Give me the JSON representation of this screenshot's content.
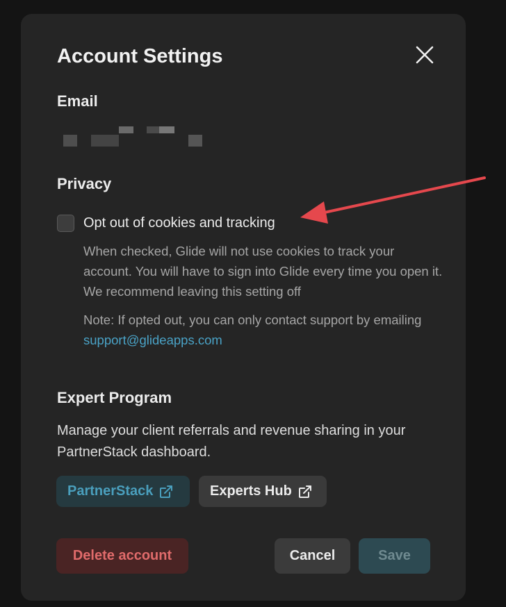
{
  "dialog": {
    "title": "Account Settings",
    "close_icon": "close-icon"
  },
  "email": {
    "heading": "Email"
  },
  "privacy": {
    "heading": "Privacy",
    "checkbox_label": "Opt out of cookies and tracking",
    "checked": false,
    "description": "When checked, Glide will not use cookies to track your account. You will have to sign into Glide every time you open it. We recommend leaving this setting off",
    "note_prefix": "Note: If opted out, you can only contact support by emailing ",
    "support_email": "support@glideapps.com"
  },
  "expert_program": {
    "heading": "Expert Program",
    "description": "Manage your client referrals and revenue sharing in your PartnerStack dashboard.",
    "partnerstack_label": "PartnerStack",
    "experts_hub_label": "Experts Hub",
    "link_icon": "external-link-icon"
  },
  "footer": {
    "delete_label": "Delete account",
    "cancel_label": "Cancel",
    "save_label": "Save"
  },
  "colors": {
    "accent": "#4aa3c7",
    "danger": "#e06b6b",
    "annotation_arrow": "#e5484d"
  }
}
